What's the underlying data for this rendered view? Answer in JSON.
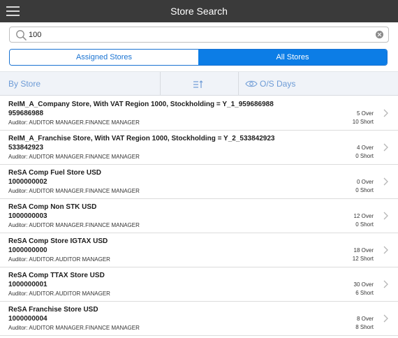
{
  "header": {
    "title": "Store Search"
  },
  "search": {
    "value": "100"
  },
  "tabs": [
    {
      "label": "Assigned Stores",
      "active": false
    },
    {
      "label": "All Stores",
      "active": true
    }
  ],
  "sort": {
    "by_store_label": "By Store",
    "days_label": "O/S Days"
  },
  "stores": [
    {
      "name": "ReIM_A_Company Store, With VAT Region 1000, Stockholding = Y_1_959686988",
      "number": "959686988",
      "auditor": "Auditor: AUDITOR  MANAGER.FINANCE  MANAGER",
      "over": "5 Over",
      "short": "10 Short"
    },
    {
      "name": "ReIM_A_Franchise Store, With VAT Region 1000, Stockholding = Y_2_533842923",
      "number": "533842923",
      "auditor": "Auditor: AUDITOR  MANAGER.FINANCE  MANAGER",
      "over": "4 Over",
      "short": "0 Short"
    },
    {
      "name": "ReSA Comp Fuel Store USD",
      "number": "1000000002",
      "auditor": "Auditor: AUDITOR  MANAGER.FINANCE  MANAGER",
      "over": "0 Over",
      "short": "0 Short"
    },
    {
      "name": "ReSA Comp Non STK USD",
      "number": "1000000003",
      "auditor": "Auditor: AUDITOR  MANAGER.FINANCE  MANAGER",
      "over": "12 Over",
      "short": "0 Short"
    },
    {
      "name": "ReSA Comp Store IGTAX USD",
      "number": "1000000000",
      "auditor": "Auditor: AUDITOR.AUDITOR  MANAGER",
      "over": "18 Over",
      "short": "12 Short"
    },
    {
      "name": "ReSA Comp TTAX Store USD",
      "number": "1000000001",
      "auditor": "Auditor: AUDITOR.AUDITOR  MANAGER",
      "over": "30 Over",
      "short": "6 Short"
    },
    {
      "name": "ReSA Franchise Store USD",
      "number": "1000000004",
      "auditor": "Auditor: AUDITOR  MANAGER.FINANCE  MANAGER",
      "over": "8 Over",
      "short": "8 Short"
    }
  ],
  "colors": {
    "titlebar": "#3a3a3a",
    "accent": "#0c7de6",
    "sortbar": "#f0f3f8",
    "sort_text": "#6d9bd6"
  }
}
